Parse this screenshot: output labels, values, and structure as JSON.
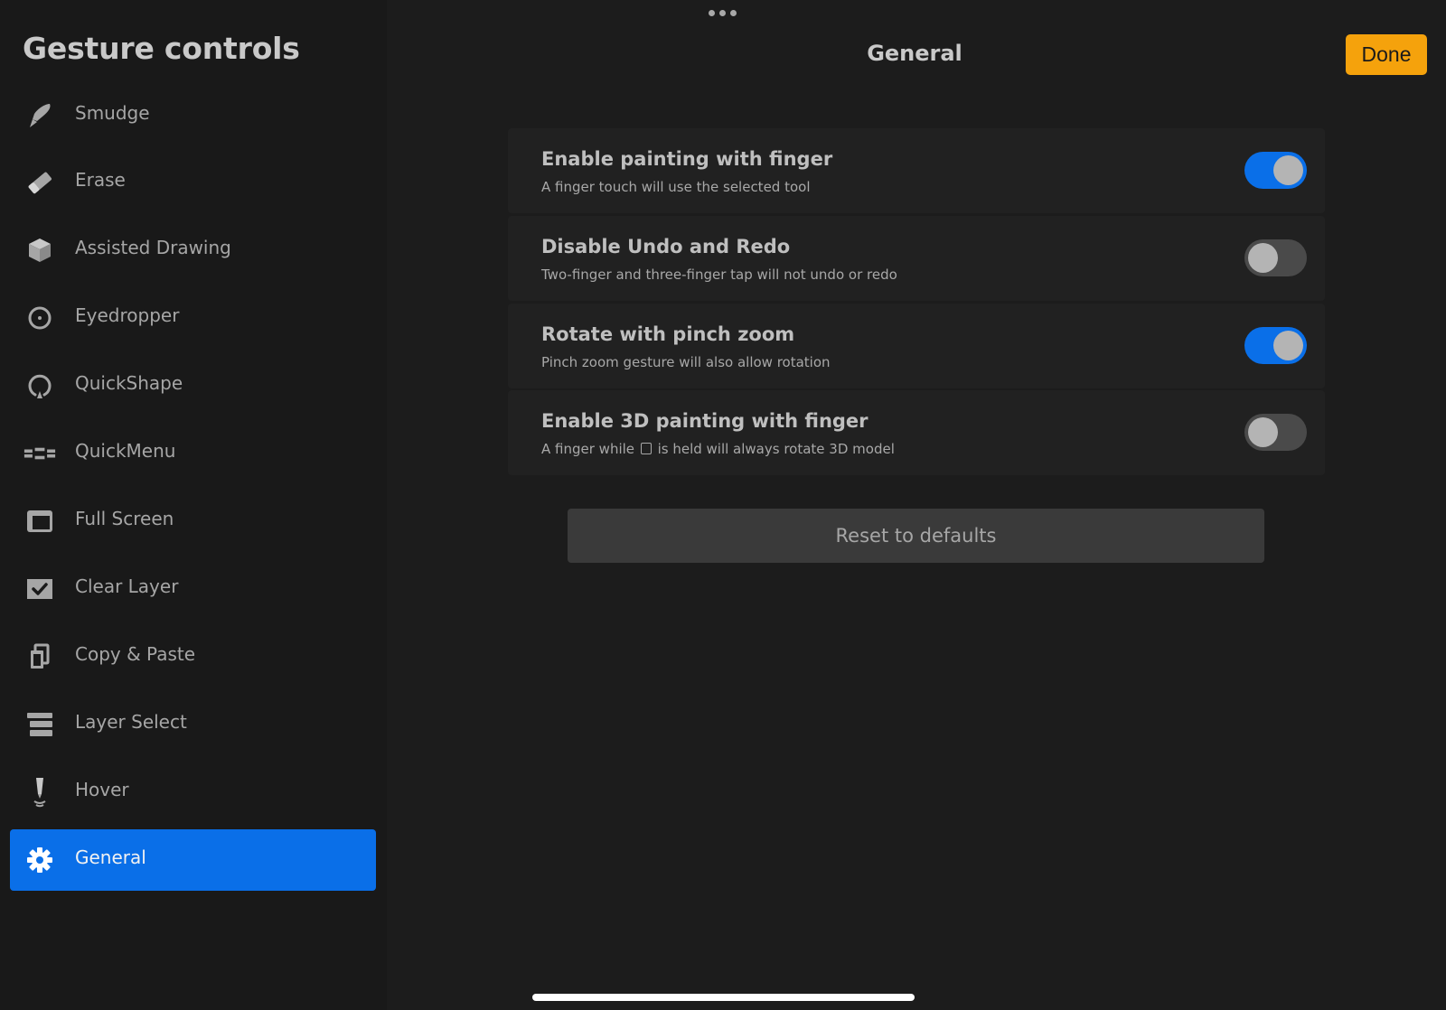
{
  "sidebar": {
    "title": "Gesture controls",
    "items": [
      {
        "label": "Smudge",
        "icon": "smudge-icon"
      },
      {
        "label": "Erase",
        "icon": "eraser-icon"
      },
      {
        "label": "Assisted Drawing",
        "icon": "cube-icon"
      },
      {
        "label": "Eyedropper",
        "icon": "eyedropper-icon"
      },
      {
        "label": "QuickShape",
        "icon": "quickshape-icon"
      },
      {
        "label": "QuickMenu",
        "icon": "quickmenu-icon"
      },
      {
        "label": "Full Screen",
        "icon": "full-screen-icon"
      },
      {
        "label": "Clear Layer",
        "icon": "clear-layer-icon"
      },
      {
        "label": "Copy & Paste",
        "icon": "copy-paste-icon"
      },
      {
        "label": "Layer Select",
        "icon": "layer-select-icon"
      },
      {
        "label": "Hover",
        "icon": "hover-icon"
      },
      {
        "label": "General",
        "icon": "gear-icon",
        "selected": true
      }
    ]
  },
  "header": {
    "title": "General",
    "done_label": "Done"
  },
  "settings": [
    {
      "title": "Enable painting with finger",
      "description": "A finger touch will use the selected tool",
      "enabled": true
    },
    {
      "title": "Disable Undo and Redo",
      "description": "Two-finger and three-finger tap will not undo or redo",
      "enabled": false
    },
    {
      "title": "Rotate with pinch zoom",
      "description": "Pinch zoom gesture will also allow rotation",
      "enabled": true
    },
    {
      "title": "Enable 3D painting with finger",
      "description_before": "A finger while",
      "description_after": "is held will always rotate 3D model",
      "enabled": false
    }
  ],
  "reset_label": "Reset to defaults",
  "colors": {
    "accent": "#0a6fe8",
    "done": "#f5a20c",
    "background": "#1c1c1c"
  }
}
